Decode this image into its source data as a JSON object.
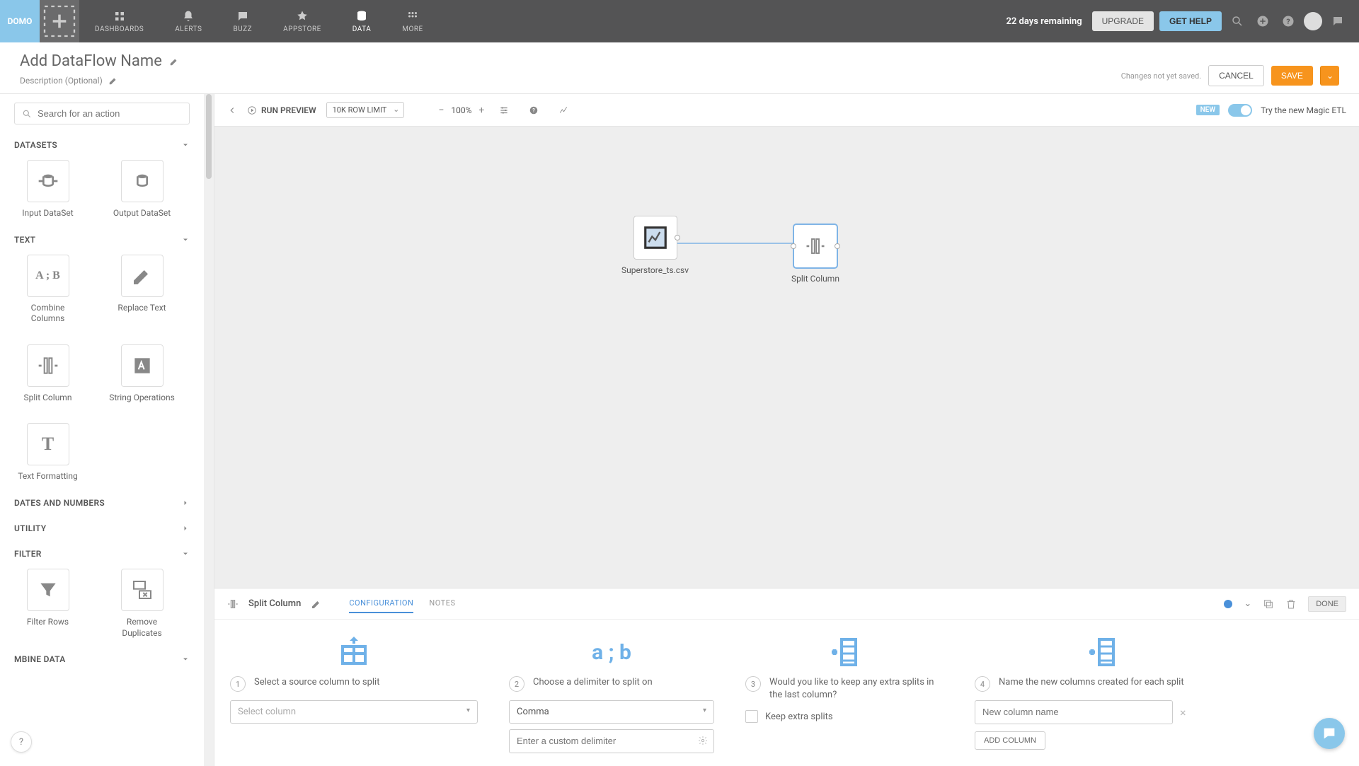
{
  "topnav": {
    "logo": "DOMO",
    "items": [
      {
        "label": "DASHBOARDS"
      },
      {
        "label": "ALERTS"
      },
      {
        "label": "BUZZ"
      },
      {
        "label": "APPSTORE"
      },
      {
        "label": "DATA"
      },
      {
        "label": "MORE"
      }
    ],
    "days_remaining": "22 days remaining",
    "upgrade": "UPGRADE",
    "get_help": "GET HELP"
  },
  "page_header": {
    "title": "Add DataFlow Name",
    "description": "Description (Optional)",
    "changes": "Changes not yet saved.",
    "cancel": "CANCEL",
    "save": "SAVE"
  },
  "sidebar": {
    "search_placeholder": "Search for an action",
    "sections": {
      "datasets": {
        "title": "DATASETS",
        "items": [
          "Input DataSet",
          "Output DataSet"
        ]
      },
      "text": {
        "title": "TEXT",
        "items": [
          "Combine Columns",
          "Replace Text",
          "Split Column",
          "String Operations",
          "Text Formatting"
        ]
      },
      "dates": {
        "title": "DATES AND NUMBERS"
      },
      "utility": {
        "title": "UTILITY"
      },
      "filter": {
        "title": "FILTER",
        "items": [
          "Filter Rows",
          "Remove Duplicates"
        ]
      },
      "combine": {
        "title": "MBINE DATA"
      }
    }
  },
  "toolbar": {
    "run_preview": "RUN PREVIEW",
    "row_limit": "10K ROW LIMIT",
    "zoom": "100%",
    "new_badge": "NEW",
    "try_text": "Try the new Magic ETL"
  },
  "canvas": {
    "node1": "Superstore_ts.csv",
    "node2": "Split Column"
  },
  "config": {
    "title": "Split Column",
    "tabs": {
      "configuration": "CONFIGURATION",
      "notes": "NOTES"
    },
    "done": "DONE",
    "step1": {
      "text": "Select a source column to split",
      "select_placeholder": "Select column"
    },
    "step2": {
      "text": "Choose a delimiter to split on",
      "select_value": "Comma",
      "custom_placeholder": "Enter a custom delimiter"
    },
    "step3": {
      "text": "Would you like to keep any extra splits in the last column?",
      "checkbox_label": "Keep extra splits"
    },
    "step4": {
      "text": "Name the new columns created for each split",
      "input_placeholder": "New column name",
      "add_column": "ADD COLUMN"
    }
  }
}
